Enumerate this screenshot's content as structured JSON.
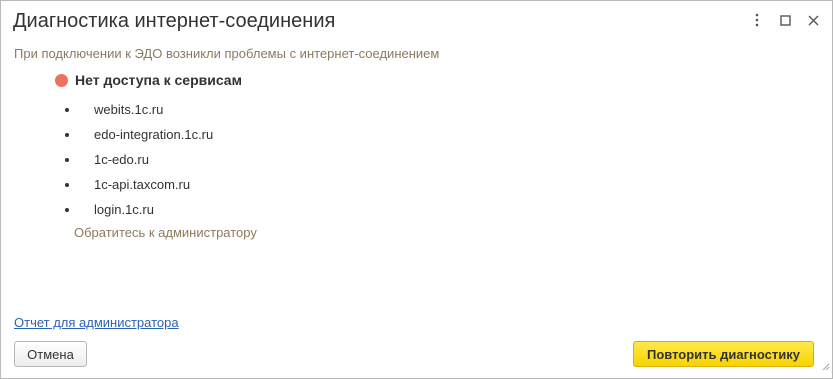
{
  "window": {
    "title": "Диагностика интернет-соединения",
    "controls": [
      {
        "icon": "more-vertical-icon"
      },
      {
        "icon": "maximize-icon"
      },
      {
        "icon": "close-icon"
      }
    ]
  },
  "subtitle": "При подключении к ЭДО возникли проблемы с интернет-соединением",
  "status": {
    "icon": "red-circle-icon",
    "color": "#f07060",
    "text": "Нет доступа к сервисам"
  },
  "hosts": [
    "webits.1c.ru",
    "edo-integration.1c.ru",
    "1c-edo.ru",
    "1c-api.taxcom.ru",
    "login.1c.ru"
  ],
  "admin_hint": "Обратитесь к администратору",
  "report_link": "Отчет для администратора",
  "buttons": {
    "cancel": "Отмена",
    "retry": "Повторить диагностику"
  },
  "colors": {
    "accent_button": "#f7d300",
    "hint_text": "#8c7a5f",
    "link": "#2b63b4"
  }
}
